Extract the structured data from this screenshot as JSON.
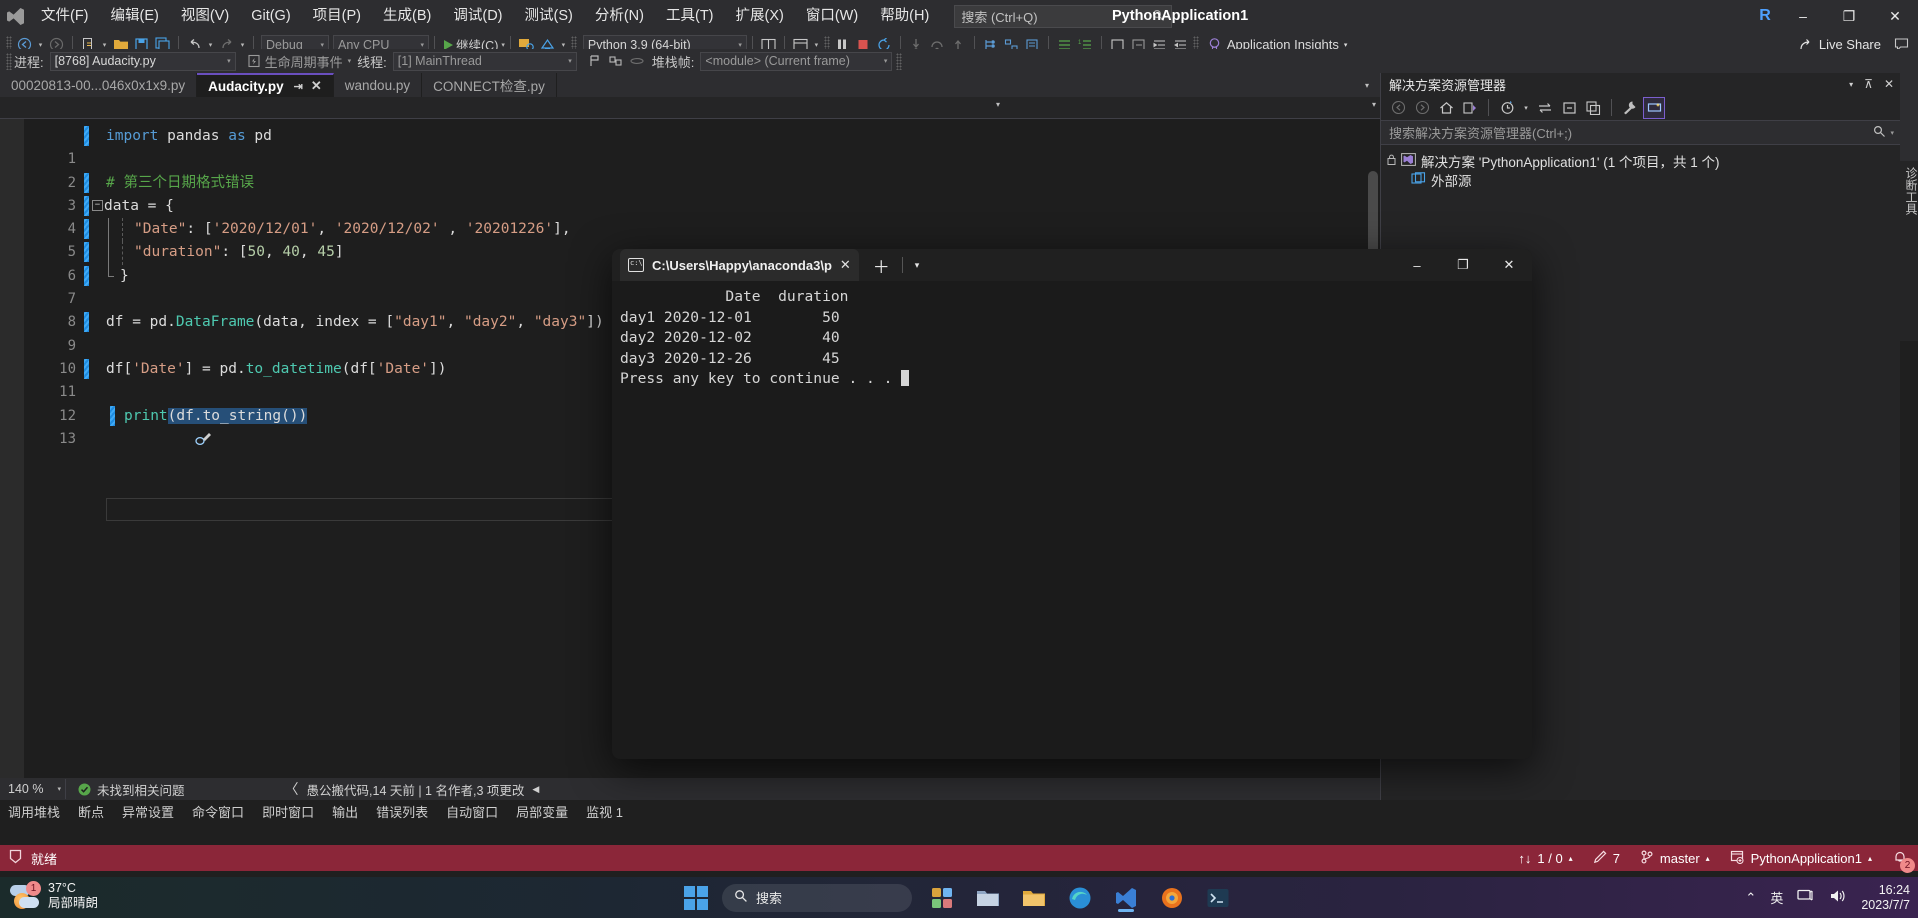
{
  "titlebar": {
    "logo_icon": "visual-studio-logo-icon",
    "menus": [
      {
        "label": "文件(F)"
      },
      {
        "label": "编辑(E)"
      },
      {
        "label": "视图(V)"
      },
      {
        "label": "Git(G)"
      },
      {
        "label": "项目(P)"
      },
      {
        "label": "生成(B)"
      },
      {
        "label": "调试(D)"
      },
      {
        "label": "测试(S)"
      },
      {
        "label": "分析(N)"
      },
      {
        "label": "工具(T)"
      },
      {
        "label": "扩展(X)"
      },
      {
        "label": "窗口(W)"
      },
      {
        "label": "帮助(H)"
      }
    ],
    "search_placeholder": "搜索 (Ctrl+Q)",
    "window_title": "PythonApplication1",
    "account_initial": "R",
    "minimize": "–",
    "restore": "❐",
    "close": "✕"
  },
  "toolbar": {
    "config_value": "Debug",
    "platform_value": "Any CPU",
    "run_label": "继续(C)",
    "interpreter_value": "Python 3.9 (64-bit)",
    "app_insights_label": "Application Insights",
    "live_share_label": "Live Share"
  },
  "debugbar": {
    "process_label": "进程:",
    "process_value": "[8768] Audacity.py",
    "lifecycle_label": "生命周期事件",
    "thread_label": "线程:",
    "thread_value": "[1] MainThread",
    "stackframe_label": "堆栈帧:",
    "stackframe_value": "<module> (Current frame)"
  },
  "tabs": [
    {
      "label": "00020813-00...046x0x1x9.py",
      "active": false
    },
    {
      "label": "Audacity.py",
      "active": true
    },
    {
      "label": "wandou.py",
      "active": false
    },
    {
      "label": "CONNECT检查.py",
      "active": false
    }
  ],
  "code": {
    "lines": [
      {
        "n": "1",
        "text": "import pandas as pd"
      },
      {
        "n": "2",
        "text": ""
      },
      {
        "n": "3",
        "text": "# 第三个日期格式错误"
      },
      {
        "n": "4",
        "text": "data = {"
      },
      {
        "n": "5",
        "text": "    \"Date\": ['2020/12/01', '2020/12/02' , '20201226'],"
      },
      {
        "n": "6",
        "text": "    \"duration\": [50, 40, 45]"
      },
      {
        "n": "7",
        "text": "}"
      },
      {
        "n": "8",
        "text": ""
      },
      {
        "n": "9",
        "text": "df = pd.DataFrame(data, index = [\"day1\", \"day2\", \"day3\"])"
      },
      {
        "n": "10",
        "text": ""
      },
      {
        "n": "11",
        "text": "df['Date'] = pd.to_datetime(df['Date'])"
      },
      {
        "n": "12",
        "text": ""
      },
      {
        "n": "13",
        "text": "print(df.to_string())"
      }
    ]
  },
  "editor_status": {
    "zoom_level": "140 %",
    "issues_label": "未找到相关问题",
    "codelens": "愚公搬代码,14 天前 | 1 名作者,3 项更改"
  },
  "solution_explorer": {
    "title": "解决方案资源管理器",
    "search_placeholder": "搜索解决方案资源管理器(Ctrl+;)",
    "tree": [
      {
        "label": "解决方案 'PythonApplication1' (1 个项目，共 1 个)",
        "indent": 0,
        "icon": "solution-icon"
      },
      {
        "label": "外部源",
        "indent": 1,
        "icon": "folder-external-icon"
      }
    ],
    "vertical_tab": "诊断工具"
  },
  "console": {
    "tab_title": "C:\\Users\\Happy\\anaconda3\\p",
    "tab_icon": "cmd-icon",
    "output_lines": [
      "            Date  duration",
      "day1 2020-12-01        50",
      "day2 2020-12-02        40",
      "day3 2020-12-26        45",
      "Press any key to continue . . . "
    ]
  },
  "dock": {
    "items": [
      "调用堆栈",
      "断点",
      "异常设置",
      "命令窗口",
      "即时窗口",
      "输出",
      "错误列表",
      "自动窗口",
      "局部变量",
      "监视 1"
    ]
  },
  "status_bar": {
    "ready_label": "就绪",
    "sync_counts": "1 / 0",
    "pending_changes": "7",
    "branch": "master",
    "repo": "PythonApplication1",
    "notification_count": "2",
    "bg_color": "#8b2639"
  },
  "taskbar": {
    "weather_temp": "37°C",
    "weather_desc": "局部晴朗",
    "weather_badge": "1",
    "search_placeholder": "搜索",
    "ime_label": "英",
    "time": "16:24",
    "date": "2023/7/7",
    "apps": [
      {
        "name": "start-button-icon"
      },
      {
        "name": "search-icon"
      },
      {
        "name": "widgets-icon"
      },
      {
        "name": "file-explorer-icon"
      },
      {
        "name": "folder-icon"
      },
      {
        "name": "edge-icon"
      },
      {
        "name": "vscode-icon"
      },
      {
        "name": "firefox-icon"
      },
      {
        "name": "terminal-icon"
      }
    ]
  },
  "colors": {
    "accent_purple": "#6a4fbf",
    "status_red": "#8b2639",
    "keyword_blue": "#569cd6",
    "string_orange": "#d69d85",
    "comment_green": "#57a64a",
    "func_teal": "#4ec9b0",
    "number_green": "#b5cea8"
  }
}
